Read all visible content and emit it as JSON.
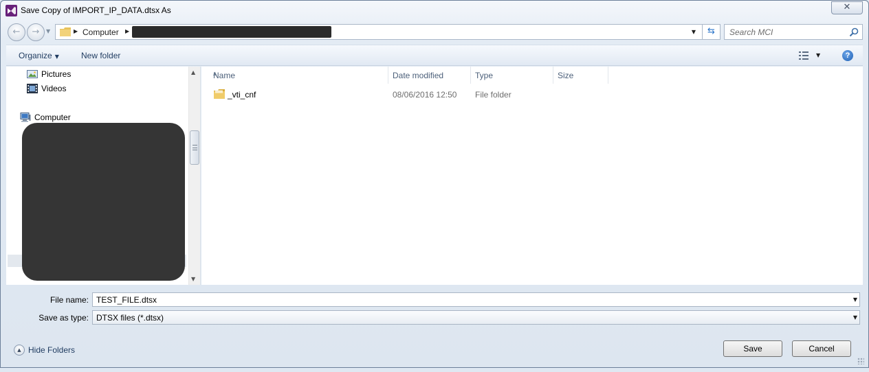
{
  "window": {
    "title": "Save Copy of IMPORT_IP_DATA.dtsx As",
    "close_glyph": "✕"
  },
  "address_bar": {
    "breadcrumb": [
      "Computer"
    ],
    "search_placeholder": "Search MCI"
  },
  "toolbar": {
    "organize_label": "Organize",
    "new_folder_label": "New folder",
    "help_glyph": "?"
  },
  "nav_pane": {
    "items": [
      {
        "label": "Pictures",
        "icon": "pictures-icon"
      },
      {
        "label": "Videos",
        "icon": "videos-icon"
      },
      {
        "label": "Computer",
        "icon": "computer-icon"
      }
    ]
  },
  "file_list": {
    "columns": [
      "Name",
      "Date modified",
      "Type",
      "Size"
    ],
    "rows": [
      {
        "name": "_vti_cnf",
        "date_modified": "08/06/2016 12:50",
        "type": "File folder",
        "size": ""
      }
    ]
  },
  "form": {
    "file_name_label": "File name:",
    "file_name_value": "TEST_FILE.dtsx",
    "save_type_label": "Save as type:",
    "save_type_value": "DTSX files (*.dtsx)"
  },
  "footer": {
    "hide_folders_label": "Hide Folders",
    "save_label": "Save",
    "cancel_label": "Cancel"
  },
  "colors": {
    "accent": "#2a74c9",
    "folder": "#e8c25a",
    "redaction": "#353535"
  }
}
